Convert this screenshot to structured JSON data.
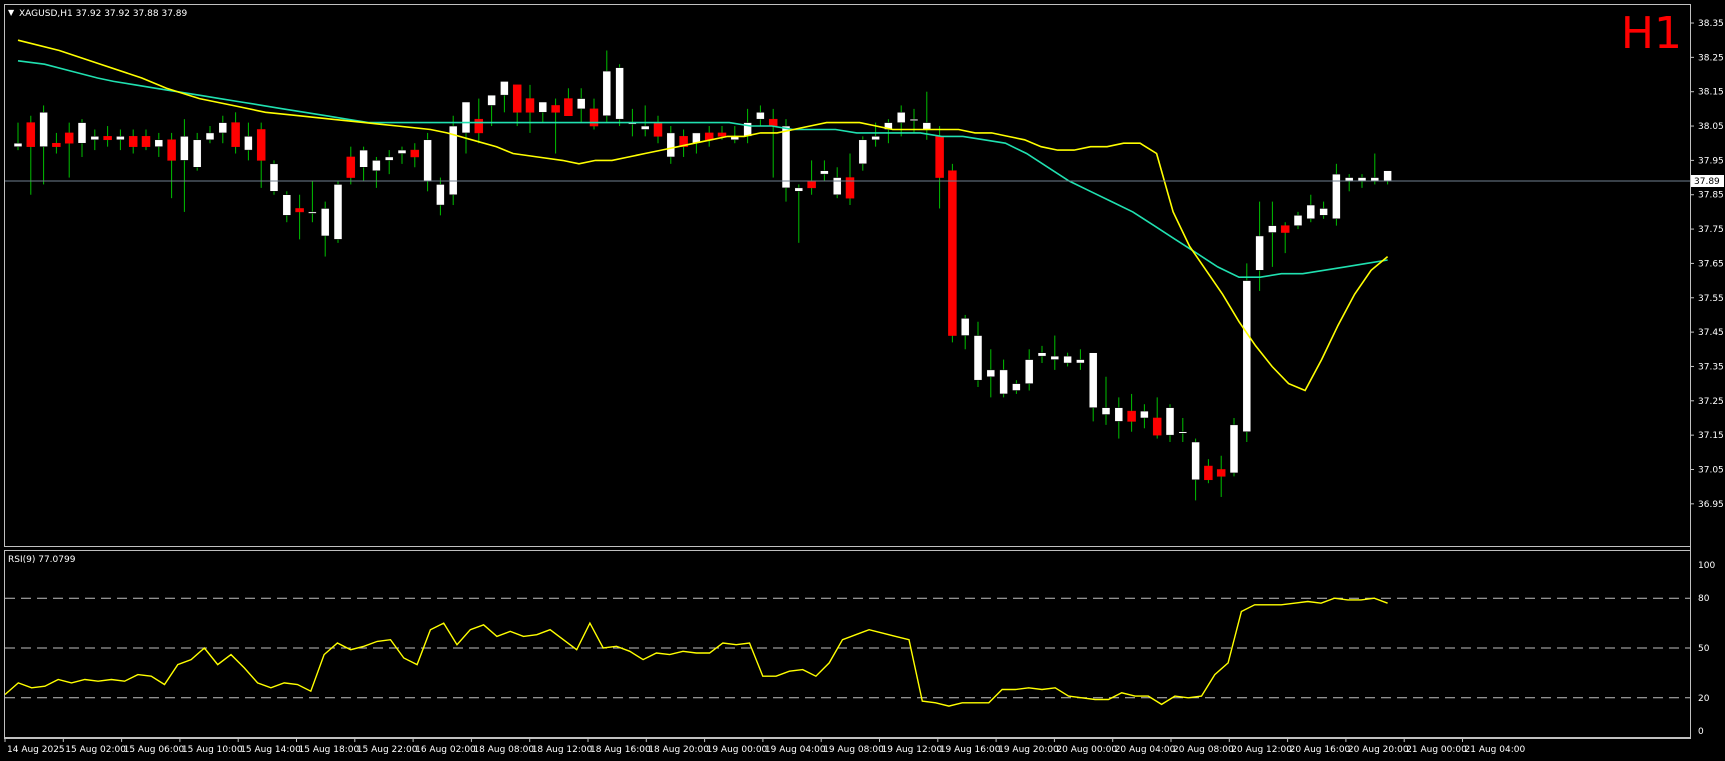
{
  "header": {
    "symbol_label": "XAGUSD,H1  37.92 37.92 37.88 37.89",
    "timeframe_badge": "H1",
    "indicator_label": "RSI(9) 77.0799"
  },
  "colors": {
    "background": "#000000",
    "bull_candle": "#ffffff",
    "bear_candle": "#ff0000",
    "wick": "#00c000",
    "ma_fast": "#ffff00",
    "ma_slow": "#20e0b0",
    "rsi_line": "#ffff00",
    "grid": "#c0c0c0",
    "badge": "#ff0000",
    "current_price_line": "#708090"
  },
  "chart_data": [
    {
      "type": "candlestick",
      "title": "XAGUSD,H1",
      "ylim": [
        36.9,
        38.4
      ],
      "y_ticks": [
        "38.35",
        "38.25",
        "38.15",
        "38.05",
        "37.95",
        "37.85",
        "37.75",
        "37.65",
        "37.55",
        "37.45",
        "37.35",
        "37.25",
        "37.15",
        "37.05",
        "36.95"
      ],
      "current_price": "37.89",
      "x_tick_labels": [
        "14 Aug 2025",
        "15 Aug 02:00",
        "15 Aug 06:00",
        "15 Aug 10:00",
        "15 Aug 14:00",
        "15 Aug 18:00",
        "15 Aug 22:00",
        "16 Aug 02:00",
        "18 Aug 08:00",
        "18 Aug 12:00",
        "18 Aug 16:00",
        "18 Aug 20:00",
        "19 Aug 00:00",
        "19 Aug 04:00",
        "19 Aug 08:00",
        "19 Aug 12:00",
        "19 Aug 16:00",
        "19 Aug 20:00",
        "20 Aug 00:00",
        "20 Aug 04:00",
        "20 Aug 08:00",
        "20 Aug 12:00",
        "20 Aug 16:00",
        "20 Aug 20:00",
        "21 Aug 00:00",
        "21 Aug 04:00"
      ],
      "ohlc": [
        [
          37.99,
          38.06,
          37.98,
          38.0
        ],
        [
          38.06,
          38.08,
          37.85,
          37.99
        ],
        [
          37.99,
          38.11,
          37.88,
          38.09
        ],
        [
          38.0,
          38.03,
          37.97,
          37.99
        ],
        [
          38.03,
          38.06,
          37.9,
          38.0
        ],
        [
          38.0,
          38.07,
          37.96,
          38.06
        ],
        [
          38.01,
          38.04,
          37.98,
          38.02
        ],
        [
          38.02,
          38.05,
          37.99,
          38.01
        ],
        [
          38.01,
          38.04,
          37.98,
          38.02
        ],
        [
          38.02,
          38.04,
          37.97,
          37.99
        ],
        [
          38.02,
          38.04,
          37.98,
          37.99
        ],
        [
          37.99,
          38.03,
          37.96,
          38.01
        ],
        [
          38.01,
          38.03,
          37.84,
          37.95
        ],
        [
          37.95,
          38.07,
          37.8,
          38.02
        ],
        [
          37.93,
          38.03,
          37.92,
          38.01
        ],
        [
          38.01,
          38.05,
          38.0,
          38.03
        ],
        [
          38.03,
          38.08,
          38.0,
          38.06
        ],
        [
          38.06,
          38.09,
          37.97,
          37.99
        ],
        [
          37.98,
          38.06,
          37.95,
          38.02
        ],
        [
          38.04,
          38.06,
          37.87,
          37.95
        ],
        [
          37.86,
          37.95,
          37.85,
          37.94
        ],
        [
          37.79,
          37.86,
          37.77,
          37.85
        ],
        [
          37.81,
          37.85,
          37.72,
          37.8
        ],
        [
          37.8,
          37.89,
          37.77,
          37.8
        ],
        [
          37.73,
          37.83,
          37.67,
          37.81
        ],
        [
          37.72,
          37.89,
          37.71,
          37.88
        ],
        [
          37.96,
          37.99,
          37.88,
          37.9
        ],
        [
          37.93,
          37.99,
          37.89,
          37.98
        ],
        [
          37.92,
          37.96,
          37.87,
          37.95
        ],
        [
          37.95,
          37.98,
          37.91,
          37.96
        ],
        [
          37.97,
          37.99,
          37.94,
          37.98
        ],
        [
          37.98,
          38.0,
          37.93,
          37.96
        ],
        [
          37.89,
          38.03,
          37.86,
          38.01
        ],
        [
          37.82,
          37.9,
          37.79,
          37.88
        ],
        [
          37.85,
          38.08,
          37.82,
          38.05
        ],
        [
          38.03,
          38.11,
          37.97,
          38.12
        ],
        [
          38.07,
          38.13,
          38.0,
          38.03
        ],
        [
          38.11,
          38.14,
          38.05,
          38.14
        ],
        [
          38.14,
          38.16,
          38.09,
          38.18
        ],
        [
          38.17,
          38.17,
          38.05,
          38.09
        ],
        [
          38.13,
          38.17,
          38.03,
          38.09
        ],
        [
          38.09,
          38.11,
          38.06,
          38.12
        ],
        [
          38.11,
          38.13,
          37.97,
          38.09
        ],
        [
          38.13,
          38.16,
          38.08,
          38.08
        ],
        [
          38.1,
          38.16,
          38.06,
          38.13
        ],
        [
          38.1,
          38.13,
          38.04,
          38.05
        ],
        [
          38.08,
          38.27,
          38.06,
          38.21
        ],
        [
          38.07,
          38.23,
          38.05,
          38.22
        ],
        [
          38.06,
          38.1,
          38.02,
          38.06
        ],
        [
          38.04,
          38.11,
          38.02,
          38.05
        ],
        [
          38.06,
          38.08,
          38.0,
          38.02
        ],
        [
          37.96,
          38.05,
          37.94,
          38.03
        ],
        [
          38.02,
          38.04,
          37.96,
          37.99
        ],
        [
          38.0,
          38.03,
          37.97,
          38.03
        ],
        [
          38.03,
          38.05,
          37.99,
          38.01
        ],
        [
          38.03,
          38.05,
          38.01,
          38.02
        ],
        [
          38.01,
          38.05,
          38.0,
          38.02
        ],
        [
          38.02,
          38.1,
          38.0,
          38.06
        ],
        [
          38.07,
          38.11,
          38.05,
          38.09
        ],
        [
          38.07,
          38.1,
          37.9,
          38.05
        ],
        [
          37.87,
          38.07,
          37.83,
          38.05
        ],
        [
          37.86,
          37.88,
          37.71,
          37.87
        ],
        [
          37.89,
          37.95,
          37.85,
          37.87
        ],
        [
          37.91,
          37.95,
          37.89,
          37.92
        ],
        [
          37.85,
          37.93,
          37.84,
          37.9
        ],
        [
          37.9,
          37.97,
          37.82,
          37.84
        ],
        [
          37.94,
          38.02,
          37.92,
          38.01
        ],
        [
          38.01,
          38.06,
          37.99,
          38.02
        ],
        [
          38.04,
          38.07,
          38.0,
          38.06
        ],
        [
          38.06,
          38.11,
          38.02,
          38.09
        ],
        [
          38.07,
          38.1,
          38.03,
          38.07
        ],
        [
          38.04,
          38.15,
          38.01,
          38.06
        ],
        [
          38.02,
          38.05,
          37.81,
          37.9
        ],
        [
          37.92,
          37.94,
          37.42,
          37.44
        ],
        [
          37.44,
          37.5,
          37.4,
          37.49
        ],
        [
          37.31,
          37.48,
          37.29,
          37.44
        ],
        [
          37.32,
          37.4,
          37.26,
          37.34
        ],
        [
          37.27,
          37.37,
          37.26,
          37.34
        ],
        [
          37.28,
          37.31,
          37.27,
          37.3
        ],
        [
          37.3,
          37.4,
          37.28,
          37.37
        ],
        [
          37.38,
          37.41,
          37.36,
          37.39
        ],
        [
          37.37,
          37.44,
          37.34,
          37.38
        ],
        [
          37.36,
          37.39,
          37.35,
          37.38
        ],
        [
          37.36,
          37.4,
          37.34,
          37.37
        ],
        [
          37.23,
          37.39,
          37.19,
          37.39
        ],
        [
          37.21,
          37.32,
          37.18,
          37.23
        ],
        [
          37.19,
          37.26,
          37.14,
          37.23
        ],
        [
          37.22,
          37.27,
          37.16,
          37.19
        ],
        [
          37.2,
          37.24,
          37.17,
          37.22
        ],
        [
          37.2,
          37.26,
          37.14,
          37.15
        ],
        [
          37.15,
          37.24,
          37.13,
          37.23
        ],
        [
          37.16,
          37.2,
          37.13,
          37.16
        ],
        [
          37.02,
          37.14,
          36.96,
          37.13
        ],
        [
          37.06,
          37.08,
          37.01,
          37.02
        ],
        [
          37.05,
          37.09,
          36.97,
          37.03
        ],
        [
          37.04,
          37.2,
          37.03,
          37.18
        ],
        [
          37.16,
          37.65,
          37.13,
          37.6
        ],
        [
          37.63,
          37.83,
          37.57,
          37.73
        ],
        [
          37.74,
          37.83,
          37.64,
          37.76
        ],
        [
          37.76,
          37.77,
          37.68,
          37.74
        ],
        [
          37.76,
          37.8,
          37.75,
          37.79
        ],
        [
          37.78,
          37.85,
          37.77,
          37.82
        ],
        [
          37.79,
          37.83,
          37.78,
          37.81
        ],
        [
          37.78,
          37.94,
          37.76,
          37.91
        ],
        [
          37.89,
          37.91,
          37.86,
          37.9
        ],
        [
          37.89,
          37.91,
          37.87,
          37.9
        ],
        [
          37.89,
          37.97,
          37.88,
          37.9
        ],
        [
          37.89,
          37.92,
          37.88,
          37.92
        ]
      ],
      "ma_fast": [
        38.3,
        38.27,
        38.23,
        38.19,
        38.16,
        38.13,
        38.11,
        38.09,
        38.08,
        38.07,
        38.06,
        38.05,
        38.04,
        38.03,
        38.01,
        37.99,
        37.97,
        37.96,
        37.95,
        37.94,
        37.95,
        37.95,
        37.96,
        37.97,
        37.98,
        37.99,
        38.0,
        38.01,
        38.02,
        38.02,
        38.03,
        38.03,
        38.04,
        38.05,
        38.06,
        38.06,
        38.06,
        38.05,
        38.04,
        38.04,
        38.04,
        38.04,
        38.04,
        38.03,
        38.03,
        38.02,
        38.01,
        37.99,
        37.98,
        37.98,
        37.99,
        37.99,
        38.0,
        38.0,
        37.97,
        37.8,
        37.7,
        37.63,
        37.56,
        37.48,
        37.41,
        37.35,
        37.3,
        37.28,
        37.37,
        37.47,
        37.56,
        37.63,
        37.67
      ],
      "ma_slow": [
        38.24,
        38.23,
        38.21,
        38.19,
        38.18,
        38.17,
        38.16,
        38.15,
        38.14,
        38.13,
        38.12,
        38.11,
        38.1,
        38.09,
        38.08,
        38.07,
        38.06,
        38.06,
        38.06,
        38.06,
        38.06,
        38.06,
        38.06,
        38.06,
        38.06,
        38.06,
        38.06,
        38.06,
        38.06,
        38.06,
        38.06,
        38.06,
        38.06,
        38.06,
        38.05,
        38.05,
        38.04,
        38.04,
        38.04,
        38.03,
        38.03,
        38.03,
        38.03,
        38.02,
        38.02,
        38.01,
        38.0,
        37.97,
        37.93,
        37.89,
        37.86,
        37.83,
        37.8,
        37.76,
        37.72,
        37.68,
        37.64,
        37.61,
        37.61,
        37.62,
        37.62,
        37.63,
        37.64,
        37.65,
        37.66
      ],
      "ma_fast_x": [
        0,
        5,
        10,
        15,
        18,
        22,
        26,
        30,
        34,
        38,
        42,
        46,
        50,
        52,
        55,
        58,
        60,
        63,
        66,
        68,
        70,
        72,
        74,
        76,
        78,
        80,
        82,
        84,
        86,
        88,
        90,
        92,
        94,
        96,
        98,
        100,
        102,
        104,
        106,
        108,
        110,
        112,
        114,
        116,
        118,
        120,
        122,
        124,
        126,
        128,
        130,
        132,
        134,
        136,
        138,
        140,
        142,
        144,
        146,
        148,
        150,
        152,
        154,
        156,
        158,
        160,
        162,
        164,
        166
      ],
      "ma_slow_x": [
        0,
        5,
        10,
        15,
        18,
        22,
        26,
        30,
        34,
        38,
        42,
        46,
        50,
        54,
        58,
        62,
        66,
        70,
        74,
        78,
        82,
        86,
        90,
        94,
        98,
        102,
        106,
        110,
        114,
        118,
        122,
        126,
        130,
        134,
        138,
        142,
        146,
        150,
        154,
        158,
        162,
        166,
        170,
        174,
        178,
        182,
        186,
        190,
        194,
        198,
        202,
        206,
        210,
        214,
        218,
        222,
        226,
        230,
        234,
        238,
        242,
        246,
        250,
        254,
        258
      ]
    },
    {
      "type": "line",
      "title": "RSI(9) 77.0799",
      "ylim": [
        0,
        100
      ],
      "y_ticks": [
        "100",
        "80",
        "50",
        "20",
        "0"
      ],
      "levels": [
        80,
        50,
        20
      ],
      "series": [
        {
          "name": "RSI(9)",
          "values": [
            22,
            29,
            26,
            27,
            31,
            29,
            31,
            30,
            31,
            30,
            34,
            33,
            28,
            40,
            43,
            50,
            40,
            46,
            38,
            29,
            26,
            29,
            28,
            24,
            46,
            53,
            49,
            51,
            54,
            55,
            44,
            40,
            61,
            65,
            52,
            61,
            64,
            57,
            60,
            57,
            58,
            61,
            55,
            49,
            65,
            50,
            51,
            48,
            43,
            47,
            46,
            48,
            47,
            47,
            53,
            52,
            53,
            33,
            33,
            36,
            37,
            33,
            41,
            55,
            58,
            61,
            59,
            57,
            55,
            18,
            17,
            15,
            17,
            17,
            17,
            25,
            25,
            26,
            25,
            26,
            21,
            20,
            19,
            19,
            23,
            21,
            21,
            16,
            21,
            20,
            21,
            34,
            41,
            72,
            76,
            76,
            76,
            77,
            78,
            77,
            80,
            79,
            79,
            80,
            77
          ]
        }
      ]
    }
  ]
}
